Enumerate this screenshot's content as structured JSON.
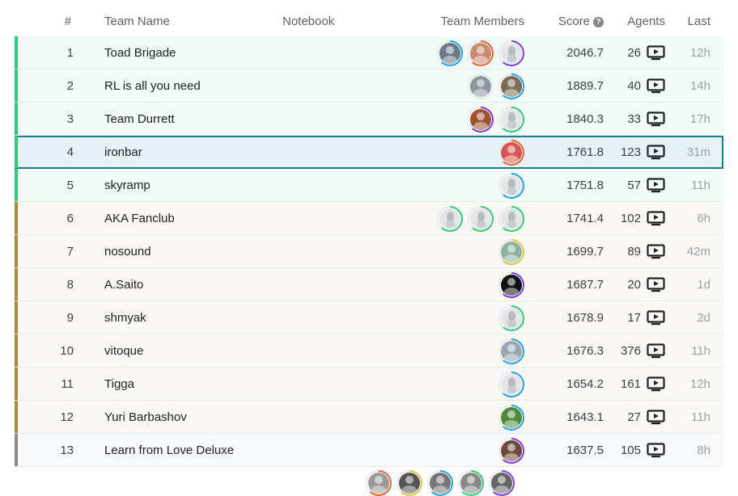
{
  "header": {
    "rank": "#",
    "team_name": "Team Name",
    "notebook": "Notebook",
    "team_members": "Team Members",
    "score": "Score",
    "agents": "Agents",
    "last": "Last"
  },
  "colors": {
    "gold_band": "#2ecc71",
    "silver_band": "#b8863b",
    "bronze_band": "#8a8a8a",
    "gold_row_bg": "#f2fbf8",
    "silver_row_bg": "#faf8f4",
    "bronze_row_bg": "#f8f9fa",
    "highlight_bg": "#e6f1f8",
    "highlight_border": "#1a7f8e"
  },
  "rows": [
    {
      "rank": "1",
      "team": "Toad Brigade",
      "score": "2046.7",
      "agents": "26",
      "last": "12h",
      "tier": "gold",
      "members": [
        {
          "ring": "#1ba1f2",
          "avatar": "photo",
          "fill": "#6b7a86"
        },
        {
          "ring": "#e8602c",
          "avatar": "photo",
          "fill": "#c98b6f"
        },
        {
          "ring": "#7c3aed",
          "avatar": "duck"
        }
      ]
    },
    {
      "rank": "2",
      "team": "RL is all you need",
      "score": "1889.7",
      "agents": "40",
      "last": "14h",
      "tier": "gold",
      "members": [
        {
          "ring": "#e8eaed",
          "avatar": "photo",
          "fill": "#8b96a0"
        },
        {
          "ring": "#1ba1f2",
          "avatar": "photo",
          "fill": "#7d6a55"
        }
      ]
    },
    {
      "rank": "3",
      "team": "Team Durrett",
      "score": "1840.3",
      "agents": "33",
      "last": "17h",
      "tier": "gold",
      "members": [
        {
          "ring": "#7c3aed",
          "avatar": "photo",
          "fill": "#a0522d"
        },
        {
          "ring": "#2ecc71",
          "avatar": "duck"
        }
      ]
    },
    {
      "rank": "4",
      "team": "ironbar",
      "score": "1761.8",
      "agents": "123",
      "last": "31m",
      "tier": "gold",
      "highlight": true,
      "members": [
        {
          "ring": "#e8602c",
          "avatar": "photo",
          "fill": "#d9534f"
        }
      ]
    },
    {
      "rank": "5",
      "team": "skyramp",
      "score": "1751.8",
      "agents": "57",
      "last": "11h",
      "tier": "gold",
      "members": [
        {
          "ring": "#1ba1f2",
          "avatar": "duck"
        }
      ]
    },
    {
      "rank": "6",
      "team": "AKA Fanclub",
      "score": "1741.4",
      "agents": "102",
      "last": "6h",
      "tier": "silver",
      "members": [
        {
          "ring": "#2ecc71",
          "avatar": "duck"
        },
        {
          "ring": "#2ecc71",
          "avatar": "duck"
        },
        {
          "ring": "#2ecc71",
          "avatar": "duck"
        }
      ]
    },
    {
      "rank": "7",
      "team": "nosound",
      "score": "1699.7",
      "agents": "89",
      "last": "42m",
      "tier": "silver",
      "members": [
        {
          "ring": "#e0c341",
          "avatar": "photo",
          "fill": "#8fb3a0"
        }
      ]
    },
    {
      "rank": "8",
      "team": "A.Saito",
      "score": "1687.7",
      "agents": "20",
      "last": "1d",
      "tier": "silver",
      "members": [
        {
          "ring": "#7c3aed",
          "avatar": "photo",
          "fill": "#111111"
        }
      ]
    },
    {
      "rank": "9",
      "team": "shmyak",
      "score": "1678.9",
      "agents": "17",
      "last": "2d",
      "tier": "silver",
      "members": [
        {
          "ring": "#2ecc71",
          "avatar": "duck"
        }
      ]
    },
    {
      "rank": "10",
      "team": "vitoque",
      "score": "1676.3",
      "agents": "376",
      "last": "11h",
      "tier": "silver",
      "members": [
        {
          "ring": "#1ba1f2",
          "avatar": "photo",
          "fill": "#9aa7b3"
        }
      ]
    },
    {
      "rank": "11",
      "team": "Tigga",
      "score": "1654.2",
      "agents": "161",
      "last": "12h",
      "tier": "silver",
      "members": [
        {
          "ring": "#1ba1f2",
          "avatar": "duck"
        }
      ]
    },
    {
      "rank": "12",
      "team": "Yuri Barbashov",
      "score": "1643.1",
      "agents": "27",
      "last": "11h",
      "tier": "silver",
      "members": [
        {
          "ring": "#1ba1f2",
          "avatar": "photo",
          "fill": "#4f8a3a"
        }
      ]
    },
    {
      "rank": "13",
      "team": "Learn from Love Deluxe",
      "score": "1637.5",
      "agents": "105",
      "last": "8h",
      "tier": "bronze",
      "members": [
        {
          "ring": "#7c3aed",
          "avatar": "photo",
          "fill": "#6d4c3d"
        }
      ]
    }
  ],
  "partial_row_members": [
    {
      "ring": "#e8602c",
      "avatar": "photo",
      "fill": "#999999"
    },
    {
      "ring": "#e0c341",
      "avatar": "photo",
      "fill": "#555555"
    },
    {
      "ring": "#1ba1f2",
      "avatar": "photo",
      "fill": "#777777"
    },
    {
      "ring": "#2ecc71",
      "avatar": "photo",
      "fill": "#888888"
    },
    {
      "ring": "#7c3aed",
      "avatar": "photo",
      "fill": "#666666"
    }
  ]
}
